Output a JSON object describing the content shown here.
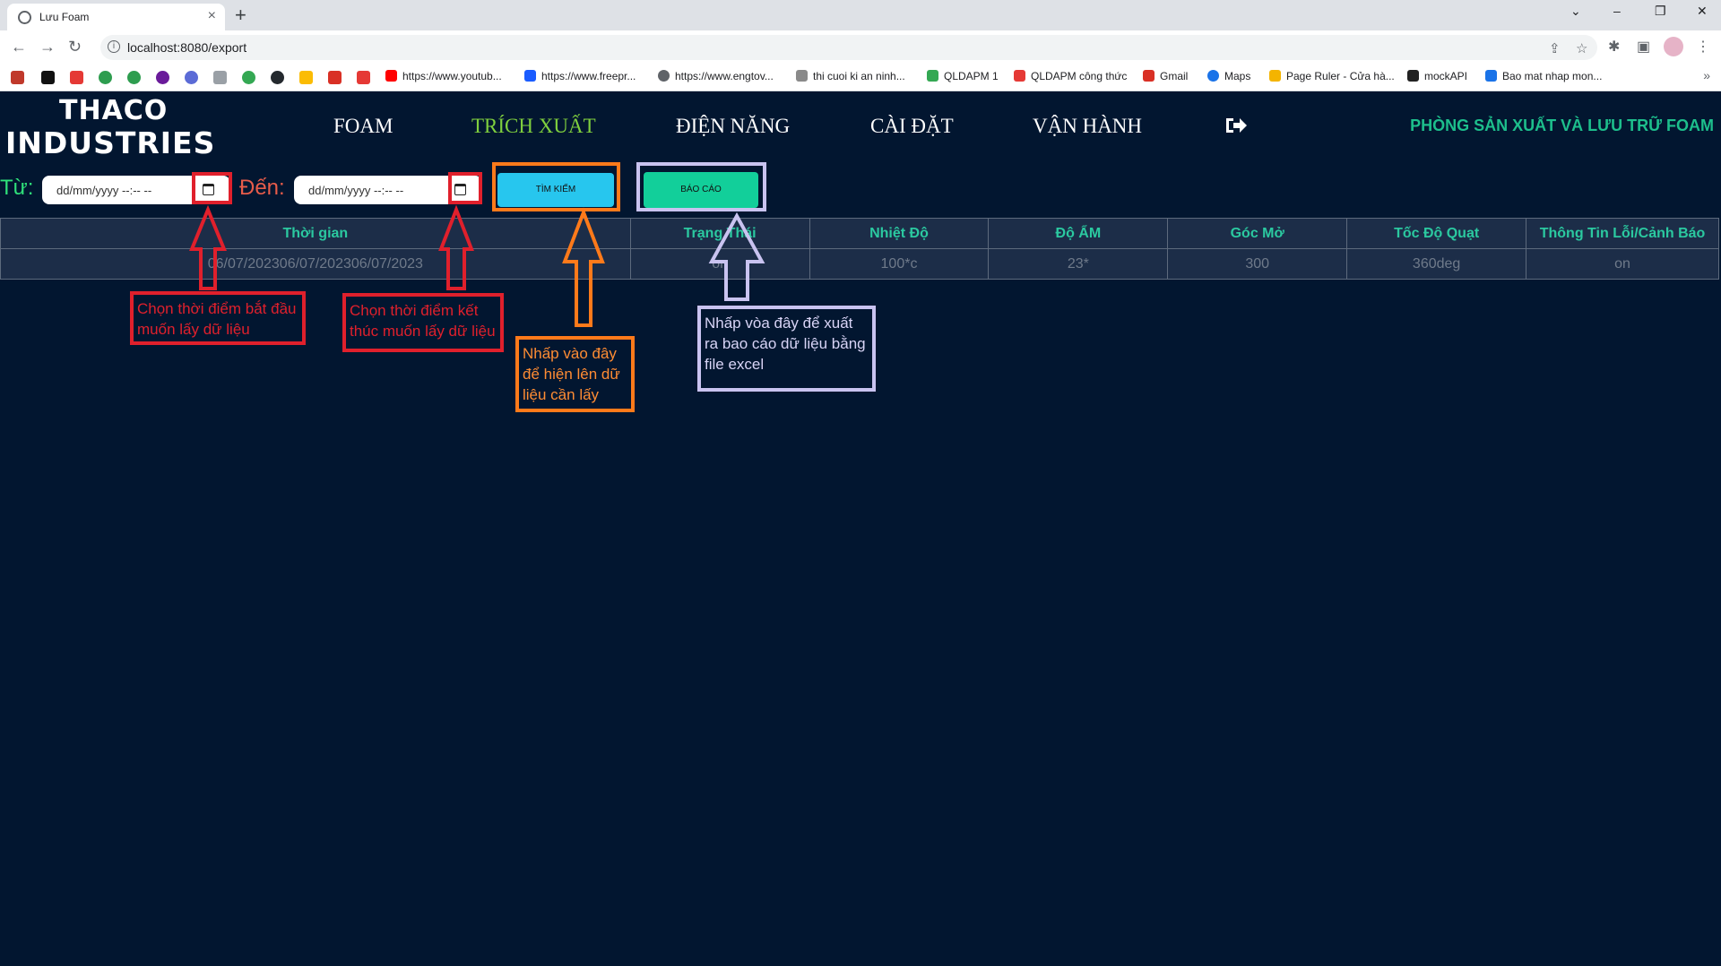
{
  "browser": {
    "tab_title": "Lưu Foam",
    "url": "localhost:8080/export",
    "bookmarks": [
      {
        "label": "https://www.youtub...",
        "color": "#ff0000"
      },
      {
        "label": "https://www.freepr...",
        "color": "#1a5cff"
      },
      {
        "label": "https://www.engtov...",
        "color": "#5f6368"
      },
      {
        "label": "thi cuoi ki an ninh...",
        "color": "#8a8a8a"
      },
      {
        "label": "QLDAPM 1",
        "color": "#34a853"
      },
      {
        "label": "QLDAPM công thức",
        "color": "#e53935"
      },
      {
        "label": "Gmail",
        "color": "#d93025"
      },
      {
        "label": "Maps",
        "color": "#1a73e8"
      },
      {
        "label": "Page Ruler - Cửa hà...",
        "color": "#f4b400"
      },
      {
        "label": "mockAPI",
        "color": "#222222"
      },
      {
        "label": "Bao mat nhap mon...",
        "color": "#1a73e8"
      }
    ]
  },
  "header": {
    "logo_line1": "THACO",
    "logo_line2": "INDUSTRIES",
    "nav": [
      {
        "label": "FOAM",
        "active": false
      },
      {
        "label": "TRÍCH XUẤT",
        "active": true
      },
      {
        "label": "ĐIỆN NĂNG",
        "active": false
      },
      {
        "label": "CÀI ĐẶT",
        "active": false
      },
      {
        "label": "VẬN HÀNH",
        "active": false
      }
    ],
    "department": "PHÒNG SẢN XUẤT VÀ LƯU TRỮ FOAM"
  },
  "filters": {
    "from_label": "Từ:",
    "to_label": "Đến:",
    "from_value": "dd/mm/yyyy --:-- --",
    "to_value": "dd/mm/yyyy --:-- --",
    "search_label": "TÌM KIẾM",
    "report_label": "BÁO CÁO"
  },
  "table": {
    "headers": [
      "Thời gian",
      "Trạng Thái",
      "Nhiệt Độ",
      "Độ ẨM",
      "Góc Mở",
      "Tốc Độ Quạt",
      "Thông Tin Lỗi/Cảnh Báo"
    ],
    "rows": [
      [
        "06/07/202306/07/202306/07/2023",
        "on",
        "100*c",
        "23*",
        "300",
        "360deg",
        "on"
      ]
    ]
  },
  "annotations": {
    "from_note": "Chọn thời điểm bắt đầu muốn lấy dữ liệu",
    "to_note": "Chọn thời điểm kết thúc muốn lấy dữ liệu",
    "search_note": "Nhấp vào đây để hiện lên dữ liệu cần lấy",
    "report_note": "Nhấp vòa đây để xuất ra bao cáo dữ liệu bằng file excel",
    "colors": {
      "red": "#e0202c",
      "orange": "#ff7a1a",
      "lavender": "#c9c3f0"
    }
  }
}
